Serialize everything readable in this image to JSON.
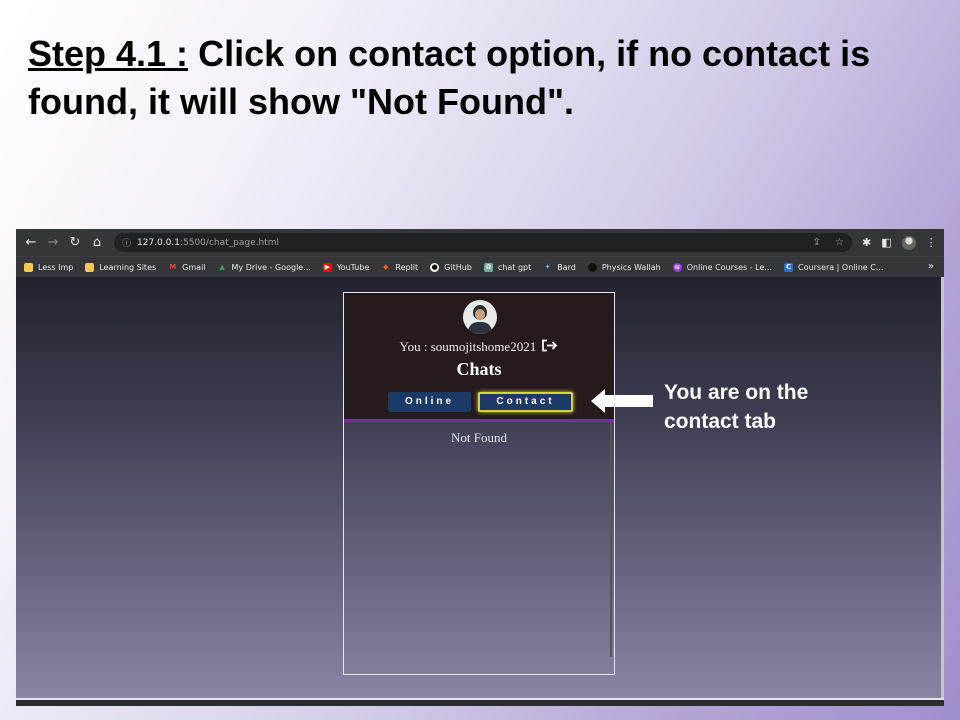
{
  "slide": {
    "step_label": "Step 4.1 :",
    "instruction": "Click on contact option, if no contact is found, it will show \"Not Found\".",
    "callout": "You are on the contact tab"
  },
  "browser": {
    "url_host": "127.0.0.1",
    "url_rest": ":5500/chat_page.html",
    "bookmarks": [
      {
        "label": "Less Imp",
        "icon": "folder-icon",
        "color": "#f2c94c"
      },
      {
        "label": "Learning Sites",
        "icon": "folder-icon",
        "color": "#f2c94c"
      },
      {
        "label": "Gmail",
        "icon": "gmail-icon",
        "color": "#ea4335"
      },
      {
        "label": "My Drive - Google...",
        "icon": "drive-icon",
        "color": "#34a853"
      },
      {
        "label": "YouTube",
        "icon": "youtube-icon",
        "color": "#ff0000"
      },
      {
        "label": "Replit",
        "icon": "replit-icon",
        "color": "#f26207"
      },
      {
        "label": "GitHub",
        "icon": "github-icon",
        "color": "#ffffff"
      },
      {
        "label": "chat gpt",
        "icon": "chatgpt-icon",
        "color": "#74aa9c"
      },
      {
        "label": "Bard",
        "icon": "bard-icon",
        "color": "#8ab4f8"
      },
      {
        "label": "Physics Wallah",
        "icon": "pw-icon",
        "color": "#111111"
      },
      {
        "label": "Online Courses - Le...",
        "icon": "udemy-icon",
        "color": "#a435f0"
      },
      {
        "label": "Coursera | Online C...",
        "icon": "coursera-icon",
        "color": "#2a73cc"
      }
    ]
  },
  "chat_app": {
    "user_text": "You : soumojitshome2021",
    "title": "Chats",
    "tabs": {
      "online": "Online",
      "contact": "Contact"
    },
    "empty_message": "Not Found",
    "colors": {
      "header_bg": "#261b1c",
      "tab_bg": "#1b3a66",
      "active_border": "#d9d33a",
      "divider": "#7b2ba6"
    }
  }
}
